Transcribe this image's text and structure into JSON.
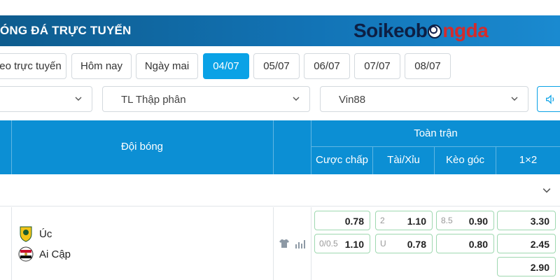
{
  "header": {
    "title": "ÓNG ĐÁ TRỰC TUYẾN",
    "logo_part1": "Soikeob",
    "logo_part2": "ngda",
    "colors": {
      "band": "#1273b5",
      "logo_dark": "#0d1f44",
      "logo_red": "#d42b2b"
    }
  },
  "tabs": [
    {
      "label": "eo trực tuyến",
      "active": false
    },
    {
      "label": "Hôm nay",
      "active": false
    },
    {
      "label": "Ngày mai",
      "active": false
    },
    {
      "label": "04/07",
      "active": true
    },
    {
      "label": "05/07",
      "active": false
    },
    {
      "label": "06/07",
      "active": false
    },
    {
      "label": "07/07",
      "active": false
    },
    {
      "label": "08/07",
      "active": false
    }
  ],
  "filters": {
    "league_select": "",
    "odds_format": "TL Thập phân",
    "bookmaker": "Vin88",
    "sound_icon": "speaker-icon"
  },
  "table_header": {
    "team_col": "Đội bóng",
    "full_match": "Toàn trận",
    "columns": [
      "Cược chấp",
      "Tài/Xỉu",
      "Kèo góc",
      "1×2"
    ]
  },
  "match": {
    "home": {
      "name": "Úc",
      "logo": "australia-fa-crest"
    },
    "away": {
      "name": "Ai Cập",
      "logo": "egypt-fa-crest"
    },
    "handicap": {
      "home": {
        "line": "",
        "odd": "0.78"
      },
      "away": {
        "line": "0/0.5",
        "odd": "1.10"
      }
    },
    "over_under": {
      "over": {
        "line": "2",
        "odd": "1.10"
      },
      "under": {
        "line": "U",
        "odd": "0.78"
      }
    },
    "corners": {
      "home": {
        "line": "8.5",
        "odd": "0.90"
      },
      "away": {
        "line": "",
        "odd": "0.80"
      }
    },
    "one_x_two": {
      "home": "3.30",
      "away": "2.45",
      "draw": "2.90"
    }
  }
}
